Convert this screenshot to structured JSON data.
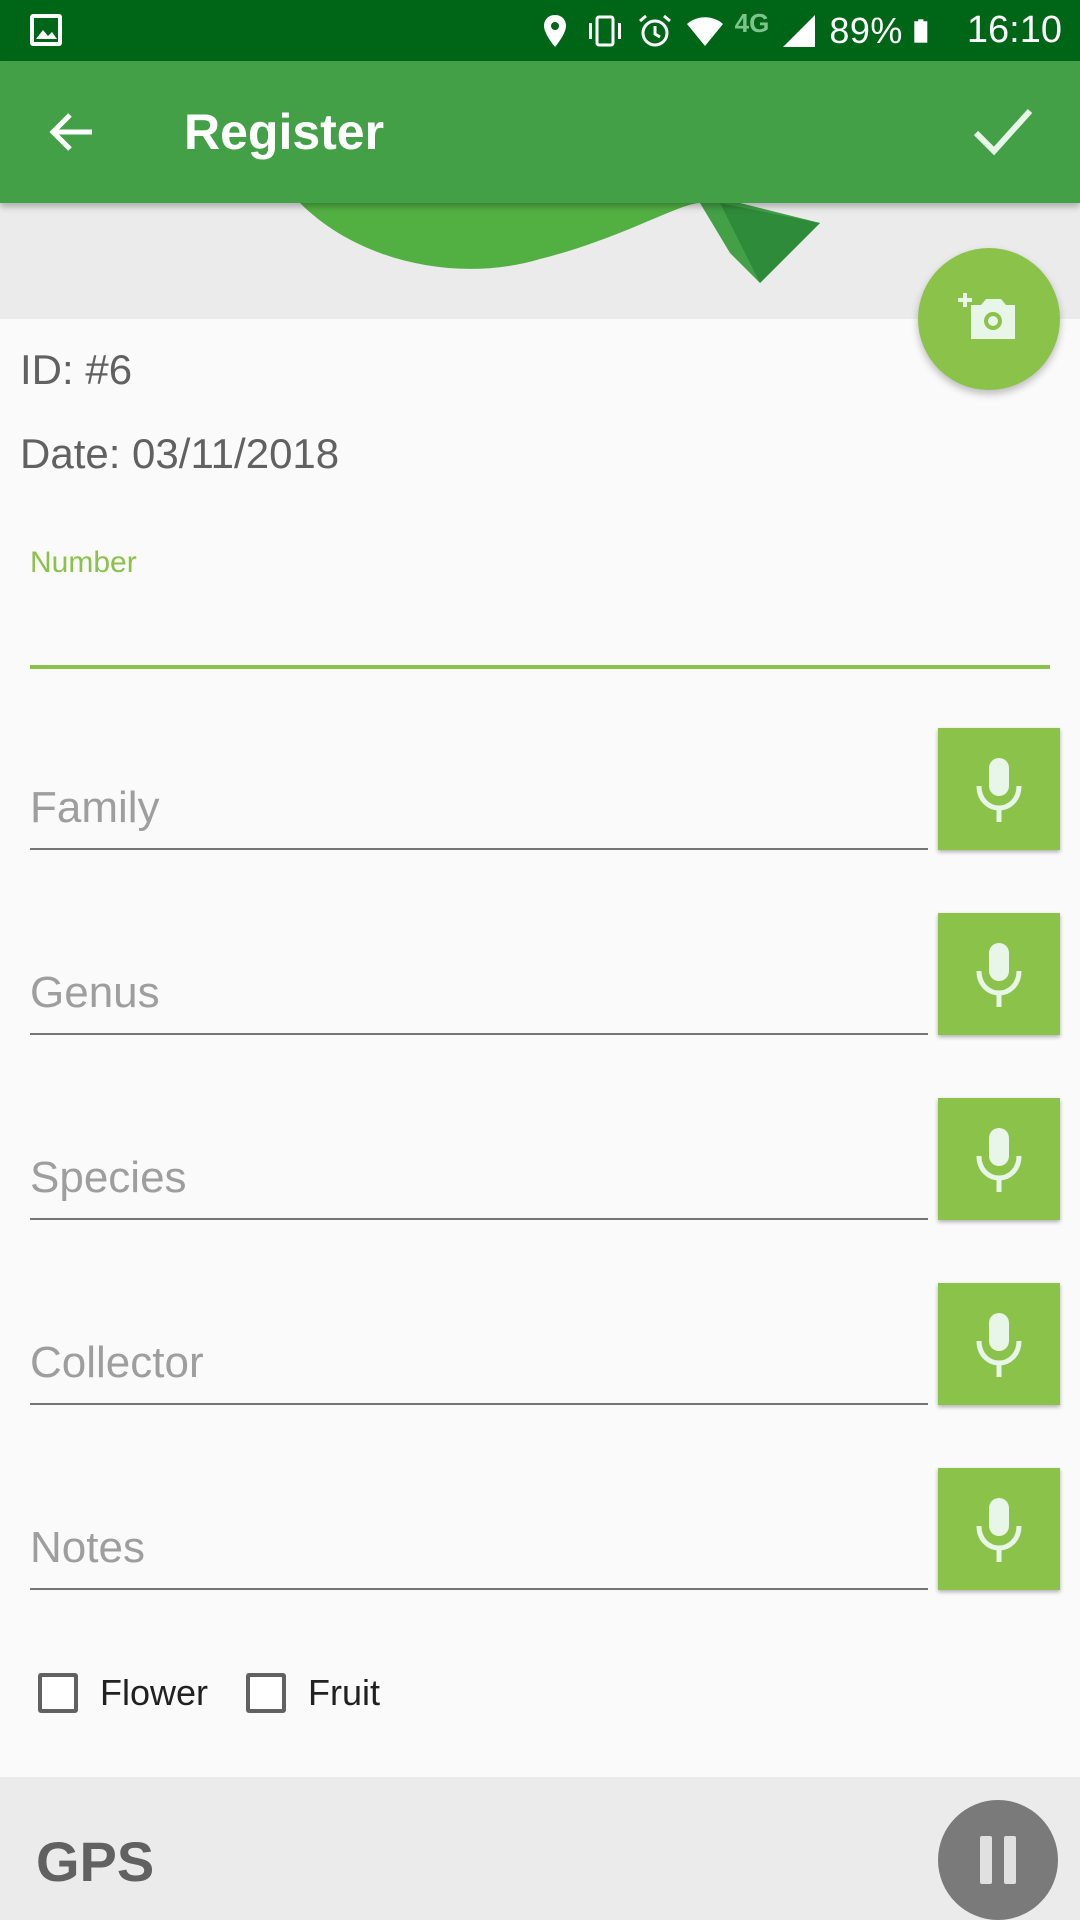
{
  "status_bar": {
    "network": "4G",
    "battery": "89%",
    "time": "16:10"
  },
  "app_bar": {
    "title": "Register"
  },
  "record": {
    "id_text": "ID: #6",
    "date_text": "Date: 03/11/2018"
  },
  "number_field": {
    "label": "Number",
    "value": ""
  },
  "fields": [
    {
      "placeholder": "Family"
    },
    {
      "placeholder": "Genus"
    },
    {
      "placeholder": "Species"
    },
    {
      "placeholder": "Collector"
    },
    {
      "placeholder": "Notes"
    }
  ],
  "checkboxes": [
    {
      "label": "Flower",
      "checked": false
    },
    {
      "label": "Fruit",
      "checked": false
    }
  ],
  "gps": {
    "title": "GPS"
  },
  "colors": {
    "status_bar": "#006617",
    "app_bar": "#43a047",
    "accent": "#8bc34a",
    "gps_bar": "#ebebeb",
    "pause_button": "#7a7a7a"
  },
  "icons": {
    "back": "arrow-back-icon",
    "confirm": "check-icon",
    "fab": "add-a-photo-icon",
    "mic": "mic-icon",
    "pause": "pause-icon"
  }
}
